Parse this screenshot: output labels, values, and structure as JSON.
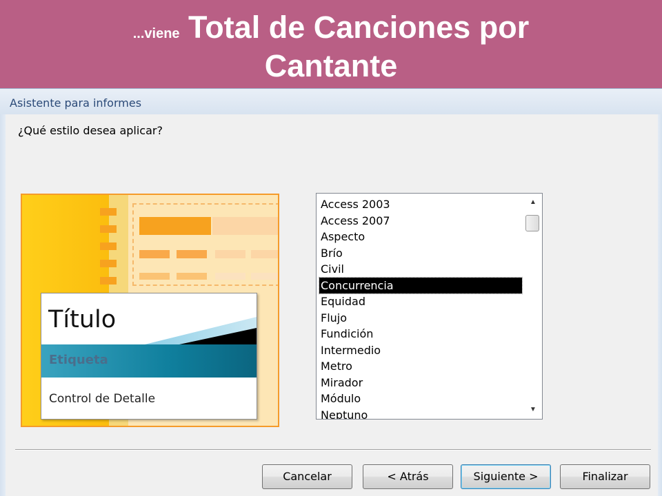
{
  "slide": {
    "title_prefix": "...viene",
    "title_main": "Total de Canciones por",
    "title_line2": "Cantante",
    "band_color": "#b95f85"
  },
  "dialog": {
    "title": "Asistente para informes",
    "question": "¿Qué estilo desea aplicar?"
  },
  "preview": {
    "title": "Título",
    "label": "Etiqueta",
    "detail": "Control de Detalle"
  },
  "styles_list": {
    "items": [
      "Access 2003",
      "Access 2007",
      "Aspecto",
      "Brío",
      "Civil",
      "Concurrencia",
      "Equidad",
      "Flujo",
      "Fundición",
      "Intermedio",
      "Metro",
      "Mirador",
      "Módulo",
      "Neptuno"
    ],
    "selected": "Concurrencia"
  },
  "buttons": {
    "cancel": "Cancelar",
    "back": "< Atrás",
    "next": "Siguiente >",
    "finish": "Finalizar"
  },
  "icons": {
    "scroll_up": "scroll-up-arrow-icon",
    "scroll_down": "scroll-down-arrow-icon"
  }
}
